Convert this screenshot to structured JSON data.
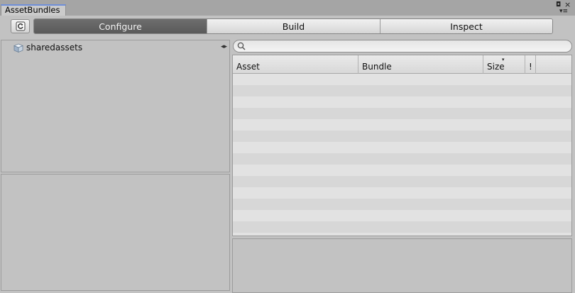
{
  "window": {
    "tab_title": "AssetBundles",
    "maximize_glyph": "◘",
    "close_glyph": "×",
    "menu_glyph": "▾≡"
  },
  "toolbar": {
    "refresh_icon": "refresh-icon",
    "modes": [
      {
        "label": "Configure",
        "active": true
      },
      {
        "label": "Build",
        "active": false
      },
      {
        "label": "Inspect",
        "active": false
      }
    ]
  },
  "bundle_tree": {
    "items": [
      {
        "label": "sharedassets",
        "icon": "cube-icon"
      }
    ],
    "divider_glyph": "◂▸"
  },
  "search": {
    "value": "",
    "placeholder": ""
  },
  "asset_table": {
    "columns": [
      {
        "label": "Asset"
      },
      {
        "label": "Bundle"
      },
      {
        "label": "Size"
      },
      {
        "label": "!"
      }
    ],
    "sort_glyph": "▾",
    "rows": []
  },
  "colors": {
    "active_mode_bg": "#5f5f5f",
    "tab_accent": "#6f8fd8",
    "panel_bg": "#c2c2c2"
  }
}
